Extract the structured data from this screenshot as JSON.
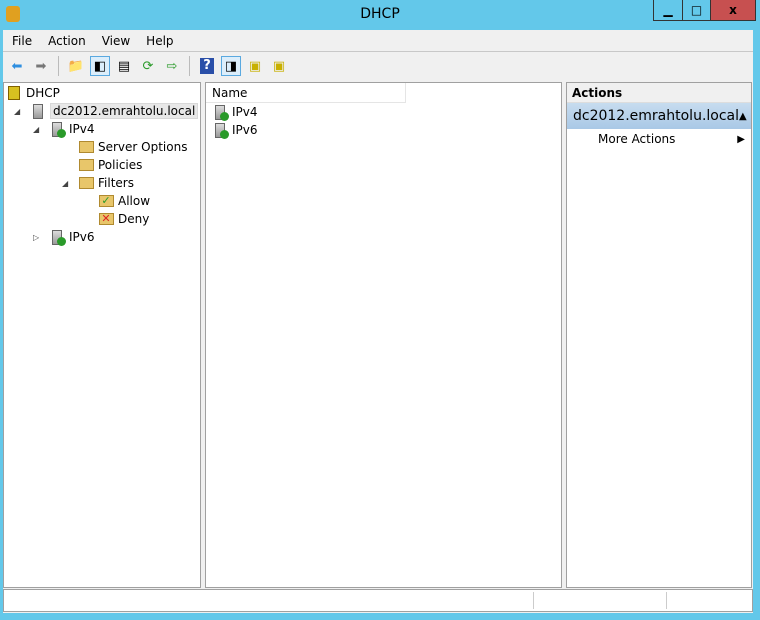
{
  "window": {
    "title": "DHCP",
    "minimize": "▁",
    "maximize": "□",
    "close": "x"
  },
  "menu": [
    "File",
    "Action",
    "View",
    "Help"
  ],
  "toolbar": [
    {
      "icon": "back-arrow-icon",
      "glyph": "⬅",
      "color": "#2f8fe0"
    },
    {
      "icon": "forward-arrow-icon",
      "glyph": "➡",
      "color": "#777777"
    },
    {
      "sep": true
    },
    {
      "icon": "up-folder-icon",
      "glyph": "📁"
    },
    {
      "icon": "show-hide-console-tree-icon",
      "glyph": "◧",
      "active": true
    },
    {
      "icon": "properties-icon",
      "glyph": "▤"
    },
    {
      "icon": "refresh-icon",
      "glyph": "⟳",
      "color": "#2a9a2a"
    },
    {
      "icon": "export-list-icon",
      "glyph": "⇨",
      "color": "#2a9a2a"
    },
    {
      "sep": true
    },
    {
      "icon": "help-icon",
      "glyph": "?",
      "color": "#2a4fa8"
    },
    {
      "icon": "show-hide-action-pane-icon",
      "glyph": "◨",
      "active": true
    },
    {
      "icon": "server-display-icon",
      "glyph": "▣",
      "color": "#c8b000"
    },
    {
      "icon": "server-multi-icon",
      "glyph": "▣",
      "color": "#c8b000"
    }
  ],
  "tree": [
    {
      "label": "DHCP",
      "icon": "dhcp-icon",
      "level": 0,
      "expander": ""
    },
    {
      "label": "dc2012.emrahtolu.local",
      "icon": "server-icon",
      "level": 1,
      "expander": "◢",
      "selected": true
    },
    {
      "label": "IPv4",
      "icon": "server-ok-icon",
      "level": 2,
      "expander": "◢"
    },
    {
      "label": "Server Options",
      "icon": "folder-icon",
      "level": 3,
      "expander": ""
    },
    {
      "label": "Policies",
      "icon": "folder-icon",
      "level": 3,
      "expander": ""
    },
    {
      "label": "Filters",
      "icon": "filter-folder-icon",
      "level": 3,
      "expander": "◢",
      "leftExp": true
    },
    {
      "label": "Allow",
      "icon": "allow-icon",
      "level": 4,
      "expander": ""
    },
    {
      "label": "Deny",
      "icon": "deny-icon",
      "level": 4,
      "expander": ""
    },
    {
      "label": "IPv6",
      "icon": "server-ok-icon",
      "level": 2,
      "expander": "▷",
      "leftExp2": true
    }
  ],
  "list": {
    "column": "Name",
    "items": [
      "IPv4",
      "IPv6"
    ]
  },
  "actions": {
    "header": "Actions",
    "selected": "dc2012.emrahtolu.local",
    "items": [
      "More Actions"
    ]
  }
}
